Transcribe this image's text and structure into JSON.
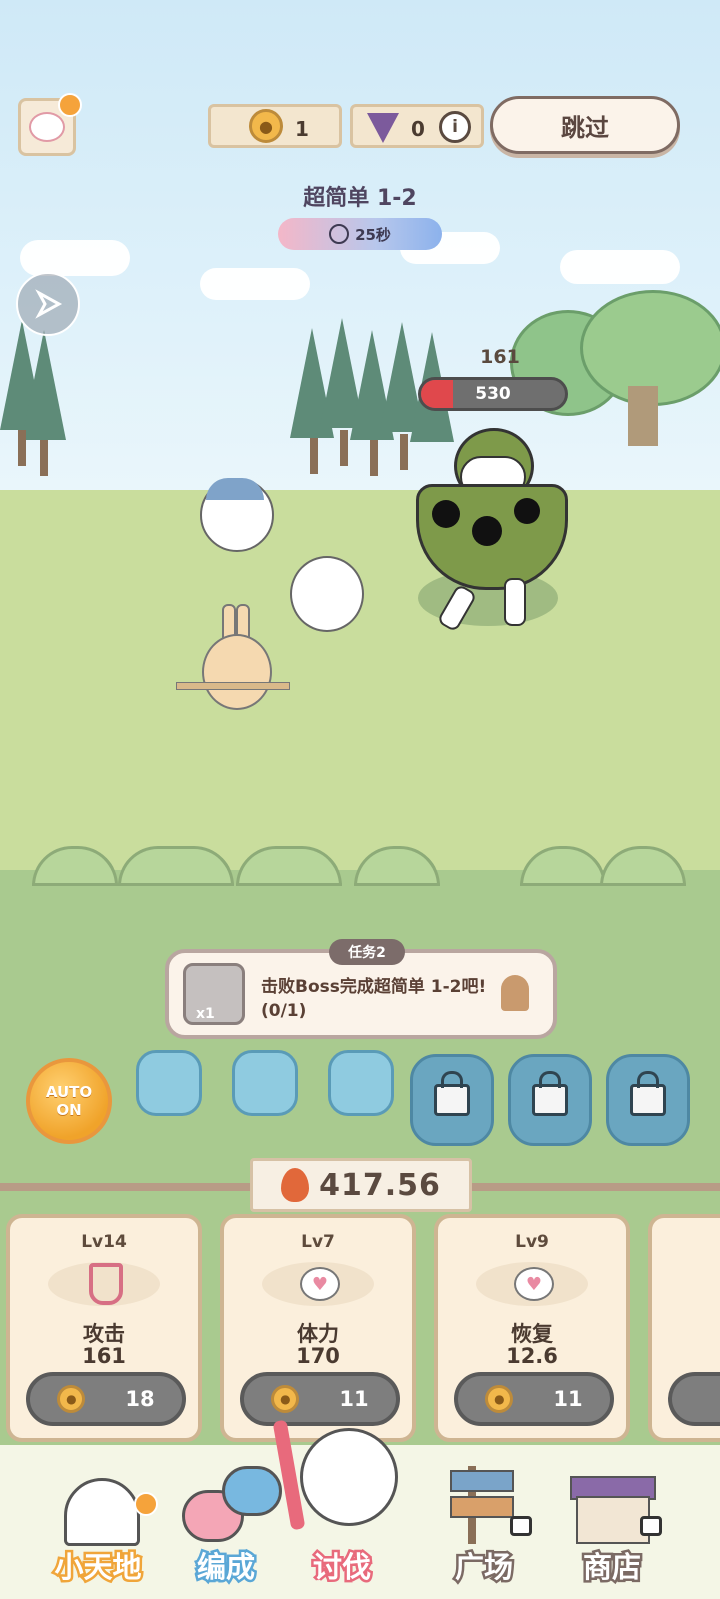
{
  "top_bar": {
    "coins": "1",
    "gems": "0",
    "info_icon": "i",
    "skip_label": "跳过"
  },
  "stage": {
    "title": "超简单 1-2",
    "timer": "25秒"
  },
  "boss": {
    "attack": "161",
    "hp_text": "530",
    "hp_fraction": 0.22
  },
  "task": {
    "badge": "任务2",
    "item_count": "x1",
    "text": "击败Boss完成超简单 1-2吧! (0/1)"
  },
  "skills": {
    "auto_line1": "AUTO",
    "auto_line2": "ON"
  },
  "power": {
    "value": "417.56"
  },
  "upgrade_cards": [
    {
      "level": "Lv14",
      "name": "攻击",
      "value": "161",
      "cost": "18",
      "icon": "claw-icon"
    },
    {
      "level": "Lv7",
      "name": "体力",
      "value": "170",
      "cost": "11",
      "icon": "heart-icon"
    },
    {
      "level": "Lv9",
      "name": "恢复",
      "value": "12.6",
      "cost": "11",
      "icon": "heal-icon"
    }
  ],
  "nav": [
    {
      "label": "小天地",
      "color": "#f0a53a"
    },
    {
      "label": "编成",
      "color": "#5aa7d6"
    },
    {
      "label": "讨伐",
      "color": "#e86a7c"
    },
    {
      "label": "广场",
      "color": "#7b6a64"
    },
    {
      "label": "商店",
      "color": "#7b6a64"
    }
  ]
}
